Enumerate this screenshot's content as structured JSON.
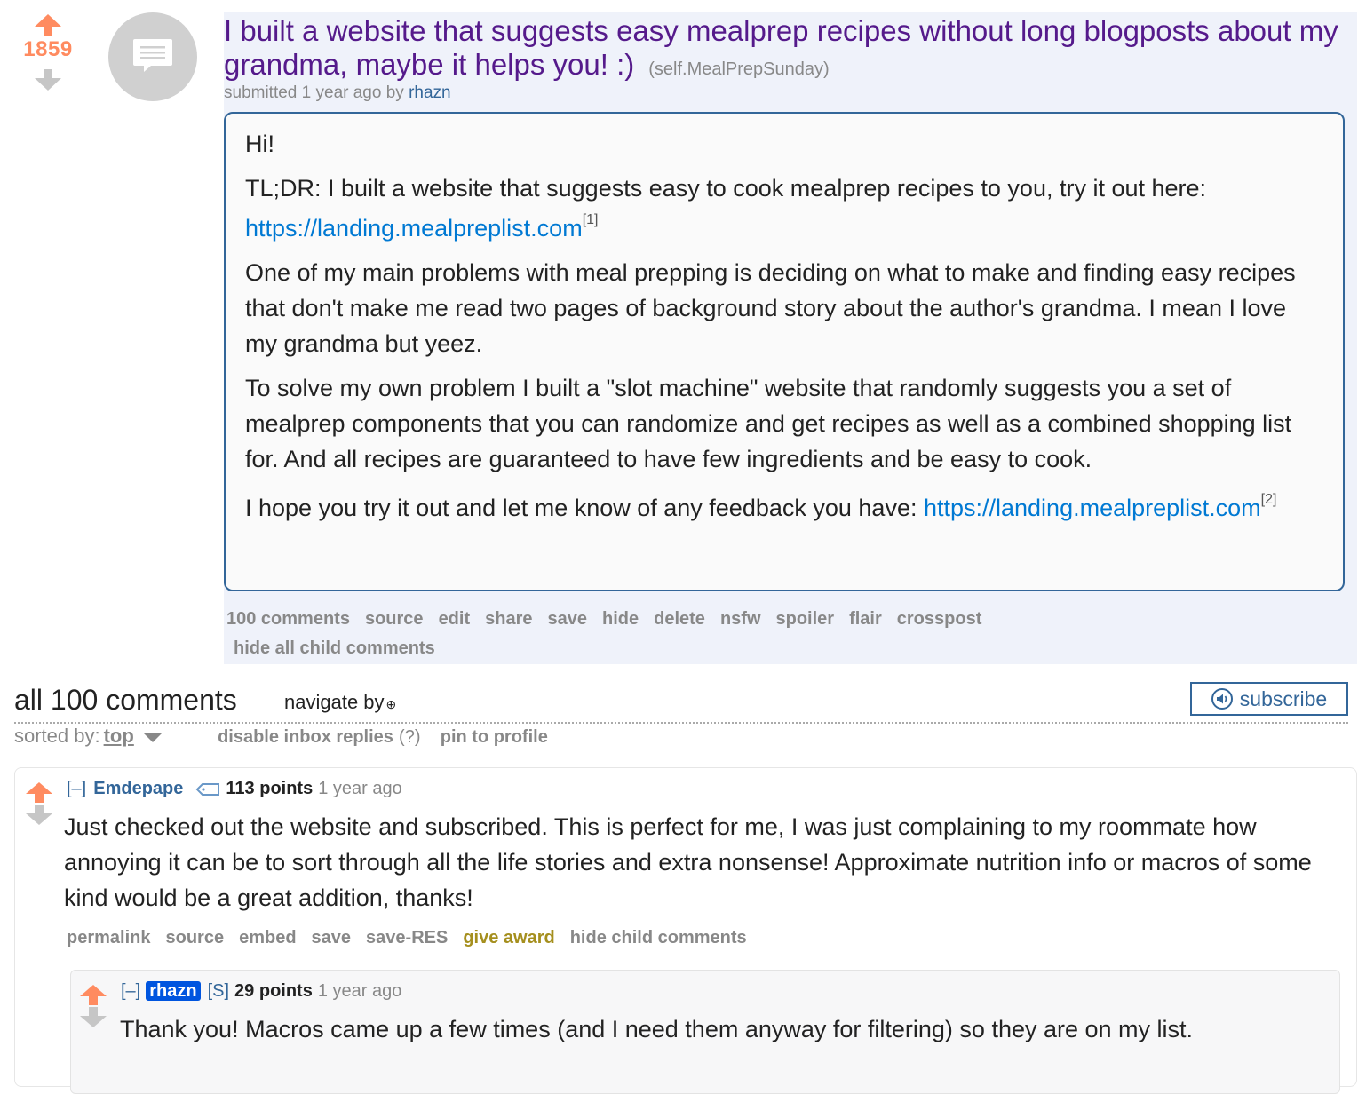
{
  "post": {
    "score": "1859",
    "title": "I built a website that suggests easy mealprep recipes without long blogposts about my grandma, maybe it helps you! :)",
    "domain": "(self.MealPrepSunday)",
    "tagline_prefix": "submitted 1 year ago by",
    "author": "rhazn",
    "body": {
      "p1": "Hi!",
      "p2_text": "TL;DR: I built a website that suggests easy to cook mealprep recipes to you, try it out here: ",
      "p2_link": "https://landing.mealpreplist.com",
      "p2_sup": "[1]",
      "p3": "One of my main problems with meal prepping is deciding on what to make and finding easy recipes that don't make me read two pages of background story about the author's grandma. I mean I love my grandma but yeez.",
      "p4": "To solve my own problem I built a \"slot machine\" website that randomly suggests you a set of mealprep components that you can randomize and get recipes as well as a combined shopping list for. And all recipes are guaranteed to have few ingredients and be easy to cook.",
      "p5_text": "I hope you try it out and let me know of any feedback you have: ",
      "p5_link": "https://landing.mealpreplist.com",
      "p5_sup": "[2]"
    },
    "buttons": [
      "100 comments",
      "source",
      "edit",
      "share",
      "save",
      "hide",
      "delete",
      "nsfw",
      "spoiler",
      "flair",
      "crosspost"
    ],
    "buttons_row2": "hide all child comments"
  },
  "comments_header": {
    "title": "all 100 comments",
    "navigate": "navigate by",
    "subscribe": "subscribe",
    "sorted_by": "sorted by:",
    "sort_value": "top",
    "disable_inbox": "disable inbox replies",
    "help": "(?)",
    "pin": "pin to profile"
  },
  "comments": [
    {
      "collapse": "[–]",
      "author": "Emdepape",
      "points": "113 points",
      "time": "1 year ago",
      "body": "Just checked out the website and subscribed. This is perfect for me, I was just complaining to my roommate how annoying it can be to sort through all the life stories and extra nonsense! Approximate nutrition info or macros of some kind would be a great addition, thanks!",
      "buttons": [
        "permalink",
        "source",
        "embed",
        "save",
        "save-RES",
        "give award",
        "hide child comments"
      ]
    },
    {
      "collapse": "[–]",
      "author": "rhazn",
      "submitter": "[S]",
      "points": "29 points",
      "time": "1 year ago",
      "body": "Thank you! Macros came up a few times (and I need them anyway for filtering) so they are on my list."
    }
  ],
  "colors": {
    "upvote": "#ff8b60",
    "downvote": "#c6c6c6",
    "title": "#551a8b",
    "link": "#0079d3",
    "author": "#336699",
    "award": "#a58f1e"
  }
}
